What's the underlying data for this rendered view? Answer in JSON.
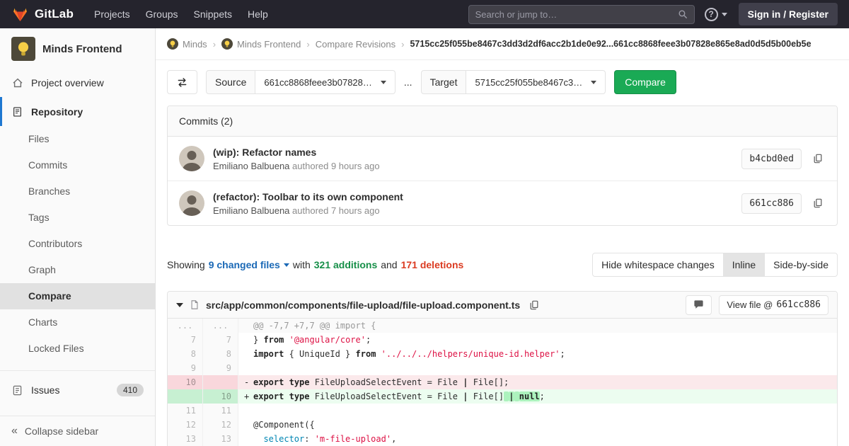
{
  "colors": {
    "brand_orange": "#fc6d26",
    "brand_red": "#e24329",
    "navbar_bg": "#25242d",
    "accent_blue": "#1f78d1",
    "link_blue": "#1b69b6",
    "button_green": "#1aaa55",
    "addition_green": "#168f48",
    "deletion_red": "#db3b21",
    "added_line_bg": "#ecfdf0",
    "removed_line_bg": "#fbe9eb"
  },
  "icons": {
    "help_glyph": "?",
    "collapse_glyph": "«"
  },
  "navbar": {
    "brand": "GitLab",
    "items": [
      "Projects",
      "Groups",
      "Snippets",
      "Help"
    ],
    "search_placeholder": "Search or jump to…",
    "sign_in_label": "Sign in / Register"
  },
  "sidebar": {
    "project_name": "Minds Frontend",
    "overview_label": "Project overview",
    "repository_label": "Repository",
    "repo_items": [
      {
        "label": "Files",
        "active": false
      },
      {
        "label": "Commits",
        "active": false
      },
      {
        "label": "Branches",
        "active": false
      },
      {
        "label": "Tags",
        "active": false
      },
      {
        "label": "Contributors",
        "active": false
      },
      {
        "label": "Graph",
        "active": false
      },
      {
        "label": "Compare",
        "active": true
      },
      {
        "label": "Charts",
        "active": false
      },
      {
        "label": "Locked Files",
        "active": false
      }
    ],
    "issues_label": "Issues",
    "issues_count": "410",
    "collapse_label": "Collapse sidebar"
  },
  "breadcrumb": {
    "separator": "›",
    "items": [
      {
        "label": "Minds",
        "has_avatar": true
      },
      {
        "label": "Minds Frontend",
        "has_avatar": true
      },
      {
        "label": "Compare Revisions",
        "has_avatar": false
      }
    ],
    "current": "5715cc25f055be8467c3dd3d2df6acc2b1de0e92...661cc8868feee3b07828e865e8ad0d5d5b00eb5e"
  },
  "compare_form": {
    "source_label": "Source",
    "source_value": "661cc8868feee3b07828…",
    "ellipsis": "...",
    "target_label": "Target",
    "target_value": "5715cc25f055be8467c3…",
    "compare_label": "Compare"
  },
  "commits": {
    "header": "Commits (2)",
    "items": [
      {
        "title": "(wip): Refactor names",
        "author": "Emiliano Balbuena",
        "meta": "authored 9 hours ago",
        "sha": "b4cbd0ed"
      },
      {
        "title": "(refactor): Toolbar to its own component",
        "author": "Emiliano Balbuena",
        "meta": "authored 7 hours ago",
        "sha": "661cc886"
      }
    ]
  },
  "diff_summary": {
    "showing_label": "Showing",
    "changed_files": "9 changed files",
    "with_label": "with",
    "additions": "321 additions",
    "and_label": "and",
    "deletions": "171 deletions",
    "whitespace_label": "Hide whitespace changes",
    "inline_label": "Inline",
    "side_by_side_label": "Side-by-side"
  },
  "file_diff": {
    "path": "src/app/common/components/file-upload/file-upload.component.ts",
    "view_file_label": "View file @",
    "view_file_sha": "661cc886",
    "lines": [
      {
        "type": "match",
        "old": "...",
        "new": "...",
        "prefix": "",
        "segments": [
          {
            "t": "@@ -7,7 +7,7 @@ import {",
            "c": "m"
          }
        ]
      },
      {
        "type": "ctx",
        "old": "7",
        "new": "7",
        "prefix": " ",
        "segments": [
          {
            "t": "} ",
            "c": "p"
          },
          {
            "t": "from",
            "c": "k"
          },
          {
            "t": " ",
            "c": "p"
          },
          {
            "t": "'@angular/core'",
            "c": "s"
          },
          {
            "t": ";",
            "c": "p"
          }
        ]
      },
      {
        "type": "ctx",
        "old": "8",
        "new": "8",
        "prefix": " ",
        "segments": [
          {
            "t": "import",
            "c": "k"
          },
          {
            "t": " { UniqueId } ",
            "c": "p"
          },
          {
            "t": "from",
            "c": "k"
          },
          {
            "t": " ",
            "c": "p"
          },
          {
            "t": "'../../../helpers/unique-id.helper'",
            "c": "s"
          },
          {
            "t": ";",
            "c": "p"
          }
        ]
      },
      {
        "type": "ctx",
        "old": "9",
        "new": "9",
        "prefix": " ",
        "segments": []
      },
      {
        "type": "del",
        "old": "10",
        "new": "",
        "prefix": "-",
        "segments": [
          {
            "t": "export",
            "c": "k"
          },
          {
            "t": " ",
            "c": "p"
          },
          {
            "t": "type",
            "c": "k"
          },
          {
            "t": " FileUploadSelectEvent = File ",
            "c": "p"
          },
          {
            "t": "|",
            "c": "k"
          },
          {
            "t": " File[];",
            "c": "p"
          }
        ]
      },
      {
        "type": "add",
        "old": "",
        "new": "10",
        "prefix": "+",
        "segments": [
          {
            "t": "export",
            "c": "k"
          },
          {
            "t": " ",
            "c": "p"
          },
          {
            "t": "type",
            "c": "k"
          },
          {
            "t": " FileUploadSelectEvent = File ",
            "c": "p"
          },
          {
            "t": "|",
            "c": "k"
          },
          {
            "t": " File[]",
            "c": "p"
          },
          {
            "t": " ",
            "c": "p hi"
          },
          {
            "t": "|",
            "c": "k hi"
          },
          {
            "t": " ",
            "c": "p hi"
          },
          {
            "t": "null",
            "c": "k hi"
          },
          {
            "t": ";",
            "c": "p"
          }
        ]
      },
      {
        "type": "ctx",
        "old": "11",
        "new": "11",
        "prefix": " ",
        "segments": []
      },
      {
        "type": "ctx",
        "old": "12",
        "new": "12",
        "prefix": " ",
        "segments": [
          {
            "t": "@Component({",
            "c": "p"
          }
        ]
      },
      {
        "type": "ctx",
        "old": "13",
        "new": "13",
        "prefix": " ",
        "segments": [
          {
            "t": "  ",
            "c": "p"
          },
          {
            "t": "selector",
            "c": "nt"
          },
          {
            "t": ": ",
            "c": "p"
          },
          {
            "t": "'m-file-upload'",
            "c": "s"
          },
          {
            "t": ",",
            "c": "p"
          }
        ]
      }
    ]
  }
}
